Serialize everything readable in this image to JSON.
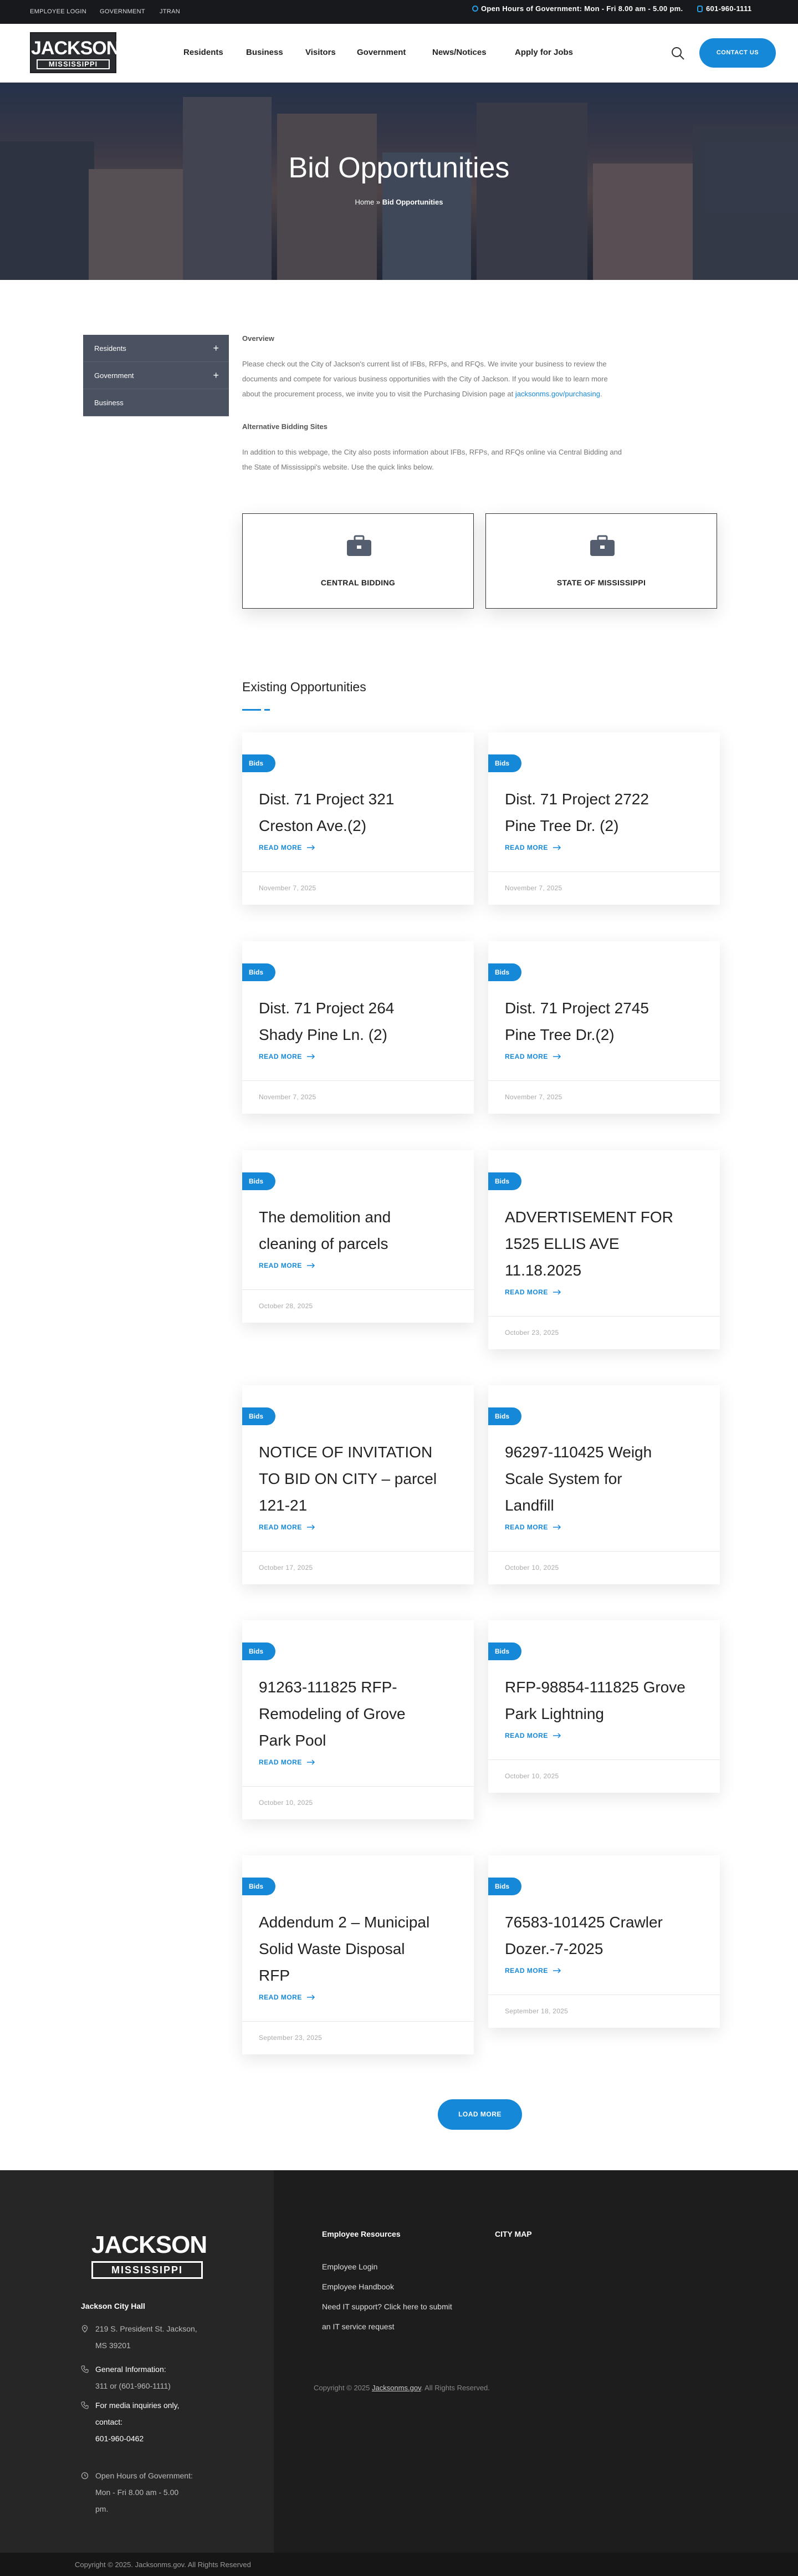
{
  "topbar": {
    "links": [
      "EMPLOYEE LOGIN",
      "GOVERNMENT",
      "JTRAN"
    ],
    "hours": "Open Hours of Government: Mon - Fri 8.00 am - 5.00 pm.",
    "phone": "601-960-1111"
  },
  "header": {
    "logo_top": "JACKSON",
    "logo_bottom": "MISSISSIPPI",
    "nav": [
      "Residents",
      "Business",
      "Visitors",
      "Government",
      "News/Notices",
      "Apply for Jobs"
    ],
    "contact_label": "CONTACT US"
  },
  "hero": {
    "title": "Bid Opportunities",
    "crumb_home": "Home",
    "crumb_sep": "»",
    "crumb_current": "Bid Opportunities"
  },
  "sidebar": {
    "items": [
      {
        "label": "Residents",
        "plus": "+"
      },
      {
        "label": "Government",
        "plus": "+"
      },
      {
        "label": "Business",
        "plus": ""
      }
    ]
  },
  "overview": {
    "title": "Overview",
    "p1_line1": "Please check out the City of Jackson's current list of IFBs, RFPs, and RFQs. We invite your business to review the",
    "p1_line2": "documents and compete for various business opportunities with the City of Jackson. If you would like to learn more",
    "p1_line3": "about the procurement process, we invite you to visit the Purchasing Division page at ",
    "p1_link": "jacksonms.gov/purchasing",
    "p1_end": ".",
    "alt_title": "Alternative Bidding Sites",
    "p2_line1": "In addition to this webpage, the City also posts information about IFBs, RFPs, and RFQs online via Central Bidding and",
    "p2_line2": "the State of Mississippi's website. Use the quick links below."
  },
  "quick_links": [
    {
      "label": "CENTRAL BIDDING",
      "icon": "briefcase-icon"
    },
    {
      "label": "STATE OF MISSISSIPPI",
      "icon": "briefcase-icon"
    }
  ],
  "existing": {
    "title": "Existing Opportunities",
    "read_more": "READ MORE",
    "cards": [
      {
        "badge": "Bids",
        "title_lines": [
          "Dist. 71 Project 321",
          "Creston Ave.(2)"
        ],
        "date": "November 7, 2025"
      },
      {
        "badge": "Bids",
        "title_lines": [
          "Dist. 71 Project 2722",
          "Pine Tree Dr. (2)"
        ],
        "date": "November 7, 2025"
      },
      {
        "badge": "Bids",
        "title_lines": [
          "Dist. 71 Project 264",
          "Shady Pine Ln. (2)"
        ],
        "date": "November 7, 2025"
      },
      {
        "badge": "Bids",
        "title_lines": [
          "Dist. 71 Project 2745",
          "Pine Tree Dr.(2)"
        ],
        "date": "November 7, 2025"
      },
      {
        "badge": "Bids",
        "title_lines": [
          "The demolition and",
          "cleaning of parcels"
        ],
        "date": "October 28, 2025"
      },
      {
        "badge": "Bids",
        "title_lines": [
          "ADVERTISEMENT FOR",
          "1525 ELLIS AVE",
          "11.18.2025"
        ],
        "date": "October 23, 2025"
      },
      {
        "badge": "Bids",
        "title_lines": [
          "NOTICE OF INVITATION",
          "TO BID ON CITY – parcel",
          "121-21"
        ],
        "date": "October 17, 2025"
      },
      {
        "badge": "Bids",
        "title_lines": [
          "96297-110425 Weigh",
          "Scale System for",
          "Landfill"
        ],
        "date": "October 10, 2025"
      },
      {
        "badge": "Bids",
        "title_lines": [
          "91263-111825 RFP-",
          "Remodeling of Grove",
          "Park Pool"
        ],
        "date": "October 10, 2025"
      },
      {
        "badge": "Bids",
        "title_lines": [
          "RFP-98854-111825 Grove",
          "Park Lightning"
        ],
        "date": "October 10, 2025"
      },
      {
        "badge": "Bids",
        "title_lines": [
          "Addendum 2 – Municipal",
          "Solid Waste Disposal",
          "RFP"
        ],
        "date": "September 23, 2025"
      },
      {
        "badge": "Bids",
        "title_lines": [
          "76583-101425 Crawler",
          "Dozer.-7-2025"
        ],
        "date": "September 18, 2025"
      }
    ],
    "load_more": "LOAD MORE"
  },
  "footer": {
    "logo_top": "JACKSON",
    "logo_bottom": "MISSISSIPPI",
    "hall_title": "Jackson City Hall",
    "address_1": "219 S. President St. Jackson,",
    "address_2": "MS 39201",
    "general_label": "General Information:",
    "general_value": "311 or (601-960-1111)",
    "media_1": "For media inquiries only,",
    "media_2": "contact:",
    "media_phone": "601-960-0462",
    "hours_1": "Open Hours of Government:",
    "hours_2": "Mon - Fri 8.00 am - 5.00",
    "hours_3": "pm.",
    "employee_title": "Employee Resources",
    "city_map": "CITY MAP",
    "employee_links": [
      "Employee Login",
      "Employee Handbook",
      "Need IT support? Click here to submit",
      "an IT service request"
    ],
    "copyright_pre": "Copyright © 2025 ",
    "copyright_link": "Jacksonms.gov",
    "copyright_post": ". All Rights Reserved.",
    "bottom_copyright": "Copyright © 2025. Jacksonms.gov. All Rights Reserved"
  },
  "colors": {
    "accent": "#1688d8",
    "dark": "#17191c",
    "sidebar": "#4a5160",
    "footer": "#1d1d1d"
  }
}
